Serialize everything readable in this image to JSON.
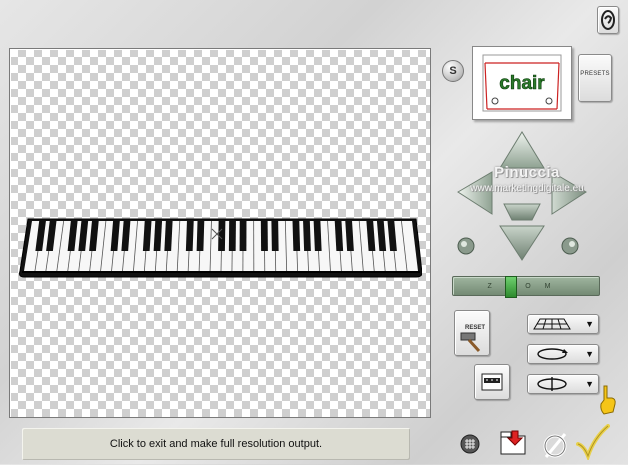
{
  "status": {
    "text": "Click to exit and make full resolution output."
  },
  "preview": {
    "text": "chair"
  },
  "presets": {
    "label": "PRESETS"
  },
  "s_button": {
    "label": "S"
  },
  "watermark": {
    "line1": "Pinuccia",
    "line2": "www.marketingdigitale.eu"
  },
  "zoom": {
    "label": "ZOOM"
  },
  "reset": {
    "label": "RESET"
  },
  "icons": {
    "help": "help-icon",
    "up": "arrow-up-icon",
    "down": "arrow-down-icon",
    "left": "arrow-left-icon",
    "right": "arrow-right-icon",
    "grid": "grid-icon",
    "folder": "folder-icon",
    "cancel": "cancel-icon",
    "ok": "checkmark-icon"
  }
}
